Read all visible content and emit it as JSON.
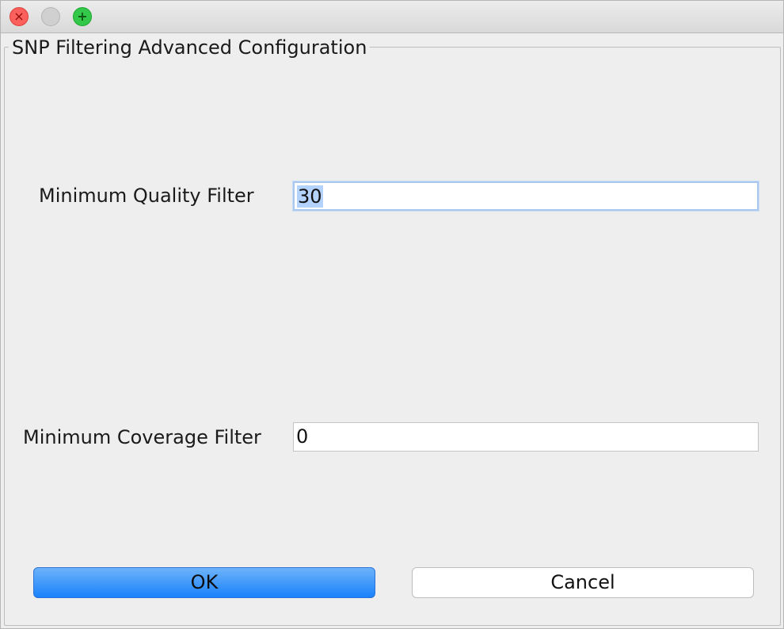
{
  "window": {
    "controls": {
      "close_glyph": "×",
      "zoom_glyph": "+"
    }
  },
  "panel": {
    "title": "SNP Filtering Advanced Configuration"
  },
  "fields": {
    "min_quality": {
      "label": "Minimum Quality Filter",
      "value": "30"
    },
    "min_coverage": {
      "label": "Minimum Coverage Filter",
      "value": "0"
    }
  },
  "buttons": {
    "ok_label": "OK",
    "cancel_label": "Cancel"
  },
  "colors": {
    "accent": "#1a82fb",
    "selection": "#b3d3fd",
    "close": "#fc605c",
    "zoom": "#34c84a"
  }
}
